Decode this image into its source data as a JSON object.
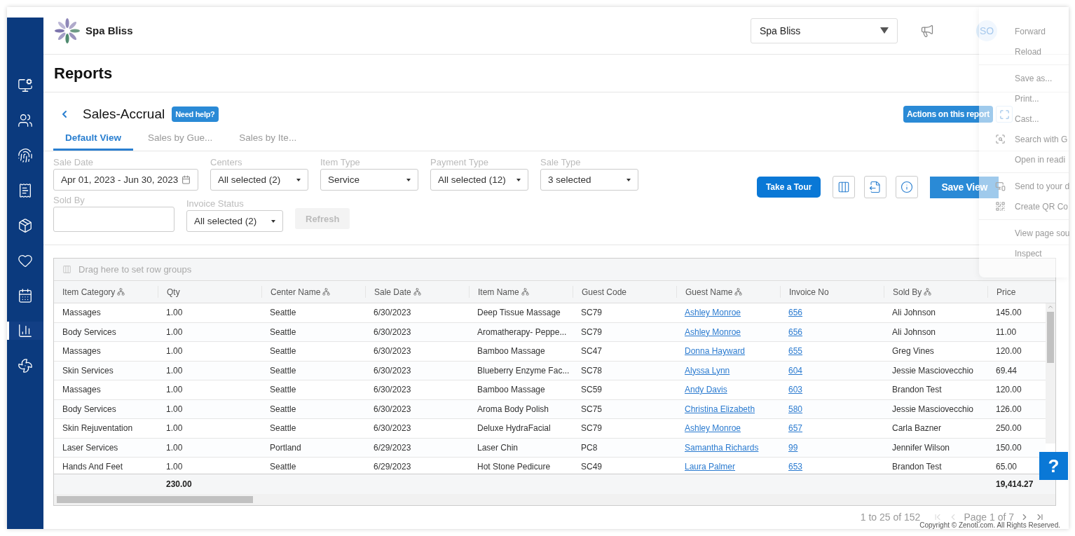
{
  "sidebar": {
    "items": [
      {
        "kind": "monitor",
        "selected": false
      },
      {
        "kind": "people",
        "selected": false
      },
      {
        "kind": "fingerprint",
        "selected": false
      },
      {
        "kind": "receipt",
        "selected": false
      },
      {
        "kind": "package",
        "selected": false
      },
      {
        "kind": "heart",
        "selected": false
      },
      {
        "kind": "calendar",
        "selected": false
      },
      {
        "kind": "chart",
        "selected": true
      },
      {
        "kind": "fan",
        "selected": false
      }
    ]
  },
  "header": {
    "brand": "Spa Bliss",
    "center_select": "Spa Bliss",
    "avatar": "SO"
  },
  "page_title": "Reports",
  "report": {
    "title": "Sales-Accrual",
    "help": "Need help?",
    "actions": "Actions on this report",
    "tabs": [
      {
        "label": "Default View",
        "selected": true
      },
      {
        "label": "Sales by Gue...",
        "selected": false
      },
      {
        "label": "Sales by Ite...",
        "selected": false
      }
    ],
    "filters": [
      [
        {
          "label": "Sale Date",
          "kind": "date",
          "value": "Apr 01, 2023 - Jun 30, 2023"
        },
        {
          "label": "Centers",
          "kind": "select",
          "value": "All selected (2)"
        },
        {
          "label": "Item Type",
          "kind": "select",
          "value": "Service"
        },
        {
          "label": "Payment Type",
          "kind": "select",
          "value": "All selected (12)"
        },
        {
          "label": "Sale Type",
          "kind": "select",
          "value": "3 selected"
        }
      ],
      [
        {
          "label": "Sold By",
          "kind": "text"
        },
        {
          "label": "Invoice Status",
          "kind": "select",
          "value": "All selected (2)"
        }
      ]
    ],
    "refresh": {
      "label": "Refresh",
      "disabled": true
    },
    "tour": "Take a Tour",
    "save_view": "Save View"
  },
  "table": {
    "group_hint": "Drag here to set row groups",
    "columns": [
      {
        "label": "Item Category",
        "groupable": true,
        "kind": "text"
      },
      {
        "label": "Qty",
        "groupable": false,
        "kind": "text",
        "total": "230.00"
      },
      {
        "label": "Center Name",
        "groupable": true,
        "kind": "text"
      },
      {
        "label": "Sale Date",
        "groupable": true,
        "kind": "text"
      },
      {
        "label": "Item Name",
        "groupable": true,
        "kind": "text"
      },
      {
        "label": "Guest Code",
        "groupable": false,
        "kind": "text"
      },
      {
        "label": "Guest Name",
        "groupable": true,
        "kind": "link"
      },
      {
        "label": "Invoice No",
        "groupable": false,
        "kind": "link"
      },
      {
        "label": "Sold By",
        "groupable": true,
        "kind": "text"
      },
      {
        "label": "Price",
        "groupable": false,
        "kind": "text",
        "total": "19,414.27"
      }
    ],
    "rows": [
      [
        "Massages",
        "1.00",
        "Seattle",
        "6/30/2023",
        "Deep Tissue Massage",
        "SC79",
        "Ashley Monroe",
        "656",
        "Ali Johnson",
        "145.00"
      ],
      [
        "Body Services",
        "1.00",
        "Seattle",
        "6/30/2023",
        "Aromatherapy- Peppe...",
        "SC79",
        "Ashley Monroe",
        "656",
        "Ali Johnson",
        "11.00"
      ],
      [
        "Massages",
        "1.00",
        "Seattle",
        "6/30/2023",
        "Bamboo Massage",
        "SC47",
        "Donna Hayward",
        "655",
        "Greg Vines",
        "120.00"
      ],
      [
        "Skin Services",
        "1.00",
        "Seattle",
        "6/30/2023",
        "Blueberry Enzyme Fac...",
        "SC78",
        "Alyssa Lynn",
        "604",
        "Jessie Masciovecchio",
        "69.44"
      ],
      [
        "Massages",
        "1.00",
        "Seattle",
        "6/30/2023",
        "Bamboo Massage",
        "SC59",
        "Andy Davis",
        "603",
        "Brandon Test",
        "120.00"
      ],
      [
        "Body Services",
        "1.00",
        "Seattle",
        "6/30/2023",
        "Aroma Body Polish",
        "SC75",
        "Christina Elizabeth",
        "580",
        "Jessie Masciovecchio",
        "126.00"
      ],
      [
        "Skin Rejuventation",
        "1.00",
        "Seattle",
        "6/30/2023",
        "Deluxe HydraFacial",
        "SC79",
        "Ashley Monroe",
        "657",
        "Carla Bazner",
        "250.00"
      ],
      [
        "Laser Services",
        "1.00",
        "Portland",
        "6/29/2023",
        "Laser Chin",
        "PC8",
        "Samantha Richards",
        "99",
        "Jennifer Wilson",
        "150.00"
      ],
      [
        "Hands And Feet",
        "1.00",
        "Seattle",
        "6/29/2023",
        "Hot Stone Pedicure",
        "SC49",
        "Laura Palmer",
        "653",
        "Brandon Test",
        "65.00"
      ]
    ]
  },
  "pagination": {
    "summary": "1 to 25 of 152",
    "page": "Page 1 of 7",
    "buttons": [
      {
        "kind": "first",
        "disabled": true
      },
      {
        "kind": "prev",
        "disabled": true
      },
      {
        "kind": "next",
        "disabled": false
      },
      {
        "kind": "last",
        "disabled": false
      }
    ]
  },
  "help_button": "?",
  "copyright": "Copyright © Zenoti.com. All Rights Reserved.",
  "context_menu": [
    [
      {
        "label": "Forward",
        "kind": "plain"
      },
      {
        "label": "Reload",
        "kind": "plain"
      }
    ],
    [
      {
        "label": "Save as...",
        "kind": "plain"
      },
      {
        "label": "Print...",
        "kind": "plain"
      },
      {
        "label": "Cast...",
        "kind": "plain"
      },
      {
        "label": "Search with G",
        "kind": "lens"
      },
      {
        "label": "Open in readi",
        "kind": "plain"
      }
    ],
    [
      {
        "label": "Send to your d",
        "kind": "device"
      },
      {
        "label": "Create QR Co",
        "kind": "qr"
      }
    ],
    [
      {
        "label": "View page sou",
        "kind": "plain"
      },
      {
        "label": "Inspect",
        "kind": "plain"
      }
    ]
  ]
}
